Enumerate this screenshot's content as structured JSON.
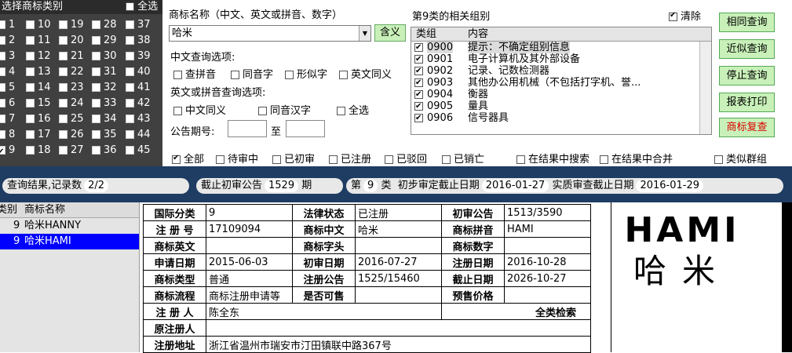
{
  "class_panel": {
    "title": "选择商标类别",
    "select_all": "全选",
    "cols": [
      [
        "1",
        "2",
        "3",
        "4",
        "5",
        "6",
        "7",
        "8",
        "9"
      ],
      [
        "10",
        "11",
        "12",
        "13",
        "14",
        "15",
        "16",
        "17",
        "18"
      ],
      [
        "19",
        "20",
        "21",
        "22",
        "23",
        "24",
        "25",
        "26",
        "27"
      ],
      [
        "28",
        "29",
        "30",
        "31",
        "32",
        "33",
        "34",
        "35",
        "36"
      ],
      [
        "37",
        "38",
        "39",
        "40",
        "41",
        "42",
        "43",
        "44",
        "45"
      ]
    ],
    "checked": [
      "9"
    ]
  },
  "search": {
    "name_label": "商标名称（中文、英文或拼音、数字）",
    "name_value": "哈米",
    "meaning_btn": "含义",
    "cn_options_label": "中文查询选项:",
    "cn_options": [
      "查拼音",
      "同音字",
      "形似字",
      "英文同义"
    ],
    "en_options_label": "英文或拼音查询选项:",
    "en_options": [
      "中文同义",
      "同音汉字",
      "全选"
    ],
    "issue_label": "公告期号:",
    "issue_to": "至"
  },
  "group": {
    "title": "第9类的相关组别",
    "clear": "清除",
    "col_group": "类组",
    "col_content": "内容",
    "rows": [
      {
        "code": "0900",
        "desc": "提示：不确定组别信息"
      },
      {
        "code": "0901",
        "desc": "电子计算机及其外部设备"
      },
      {
        "code": "0902",
        "desc": "记录、记数检测器"
      },
      {
        "code": "0903",
        "desc": "其他办公用机械（不包括打字机、誉..."
      },
      {
        "code": "0904",
        "desc": "衡器"
      },
      {
        "code": "0905",
        "desc": "量具"
      },
      {
        "code": "0906",
        "desc": "信号器具"
      }
    ]
  },
  "buttons": [
    "相同查询",
    "近似查询",
    "停止查询",
    "报表打印",
    "商标复查"
  ],
  "status_filters": [
    "全部",
    "待审中",
    "已初审",
    "已注册",
    "已驳回",
    "已销亡"
  ],
  "extra_filters": [
    "在结果中搜索",
    "在结果中合并",
    "类似群组"
  ],
  "bar": {
    "result_label": "查询结果,记录数",
    "result_value": "2/2",
    "cutoff_label": "截止初审公告",
    "cutoff_value": "1529",
    "cutoff_unit": "期",
    "class_prefix": "第",
    "class_value": "9",
    "class_unit": "类",
    "prelim_label": "初步审定截止日期",
    "prelim_value": "2016-01-27",
    "exam_label": "实质审查截止日期",
    "exam_value": "2016-01-29"
  },
  "results": {
    "col_class": "类别",
    "col_name": "商标名称",
    "rows": [
      {
        "cls": "9",
        "name": "哈米HANNY"
      },
      {
        "cls": "9",
        "name": "哈米HAMI"
      }
    ]
  },
  "detail": {
    "intl_class_k": "国际分类",
    "intl_class_v": "9",
    "legal_k": "法律状态",
    "legal_v": "已注册",
    "prelim_k": "初审公告",
    "prelim_v": "1513/3590",
    "reg_no_k": "注 册 号",
    "reg_no_v": "17109094",
    "cn_name_k": "商标中文",
    "cn_name_v": "哈米",
    "pinyin_k": "商标拼音",
    "pinyin_v": "HAMI",
    "en_k": "商标英文",
    "en_v": "",
    "letter_k": "商标字头",
    "letter_v": "",
    "digit_k": "商标数字",
    "digit_v": "",
    "apply_k": "申请日期",
    "apply_v": "2015-06-03",
    "prelim_date_k": "初审日期",
    "prelim_date_v": "2016-07-27",
    "reg_date_k": "注册日期",
    "reg_date_v": "2016-10-28",
    "type_k": "商标类型",
    "type_v": "普通",
    "reg_ann_k": "注册公告",
    "reg_ann_v": "1525/15460",
    "expire_k": "截止日期",
    "expire_v": "2026-10-27",
    "flow_k": "商标流程",
    "flow_v": "商标注册申请等",
    "presale_q_k": "是否可售",
    "presale_q_v": "",
    "presale_price_k": "预售价格",
    "presale_price_v": "",
    "registrant_k": "注 册 人",
    "registrant_v": "陈全东",
    "all_class": "全类检索",
    "orig_reg_k": "原注册人",
    "orig_reg_v": "",
    "addr_k": "注册地址",
    "addr_v": "浙江省温州市瑞安市汀田镇联中路367号"
  },
  "logo": {
    "latin": "HAMI",
    "cn": "哈米"
  }
}
